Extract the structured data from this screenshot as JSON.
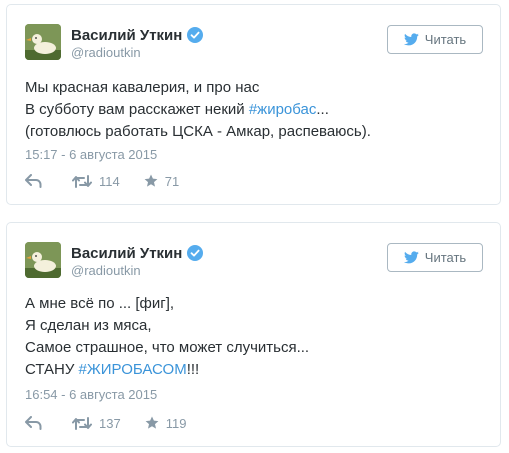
{
  "tweets": [
    {
      "author": {
        "name": "Василий Уткин",
        "handle": "@radioutkin",
        "verified": true,
        "avatar_icon": "duck-avatar"
      },
      "follow_label": "Читать",
      "lines": [
        [
          {
            "t": "Мы красная кавалерия, и про нас"
          }
        ],
        [
          {
            "t": "В субботу вам расскажет некий "
          },
          {
            "t": "#жиробас",
            "tag": true
          },
          {
            "t": "..."
          }
        ],
        [
          {
            "t": "(готовлюсь работать ЦСКА - Амкар, распеваюсь)."
          }
        ]
      ],
      "timestamp": "15:17 - 6 августа 2015",
      "retweets": "114",
      "favorites": "71"
    },
    {
      "author": {
        "name": "Василий Уткин",
        "handle": "@radioutkin",
        "verified": true,
        "avatar_icon": "duck-avatar"
      },
      "follow_label": "Читать",
      "lines": [
        [
          {
            "t": "А мне всё по ... [фиг],"
          }
        ],
        [
          {
            "t": "Я сделан из мяса,"
          }
        ],
        [
          {
            "t": "Самое страшное, что может случиться..."
          }
        ],
        [
          {
            "t": "СТАНУ "
          },
          {
            "t": "#ЖИРОБАСОМ",
            "tag": true
          },
          {
            "t": "!!!"
          }
        ]
      ],
      "timestamp": "16:54 - 6 августа 2015",
      "retweets": "137",
      "favorites": "119"
    }
  ],
  "colors": {
    "link": "#3b94d9",
    "text": "#292f33",
    "muted": "#8899a6",
    "border": "#e1e8ed",
    "verified": "#55acee"
  }
}
